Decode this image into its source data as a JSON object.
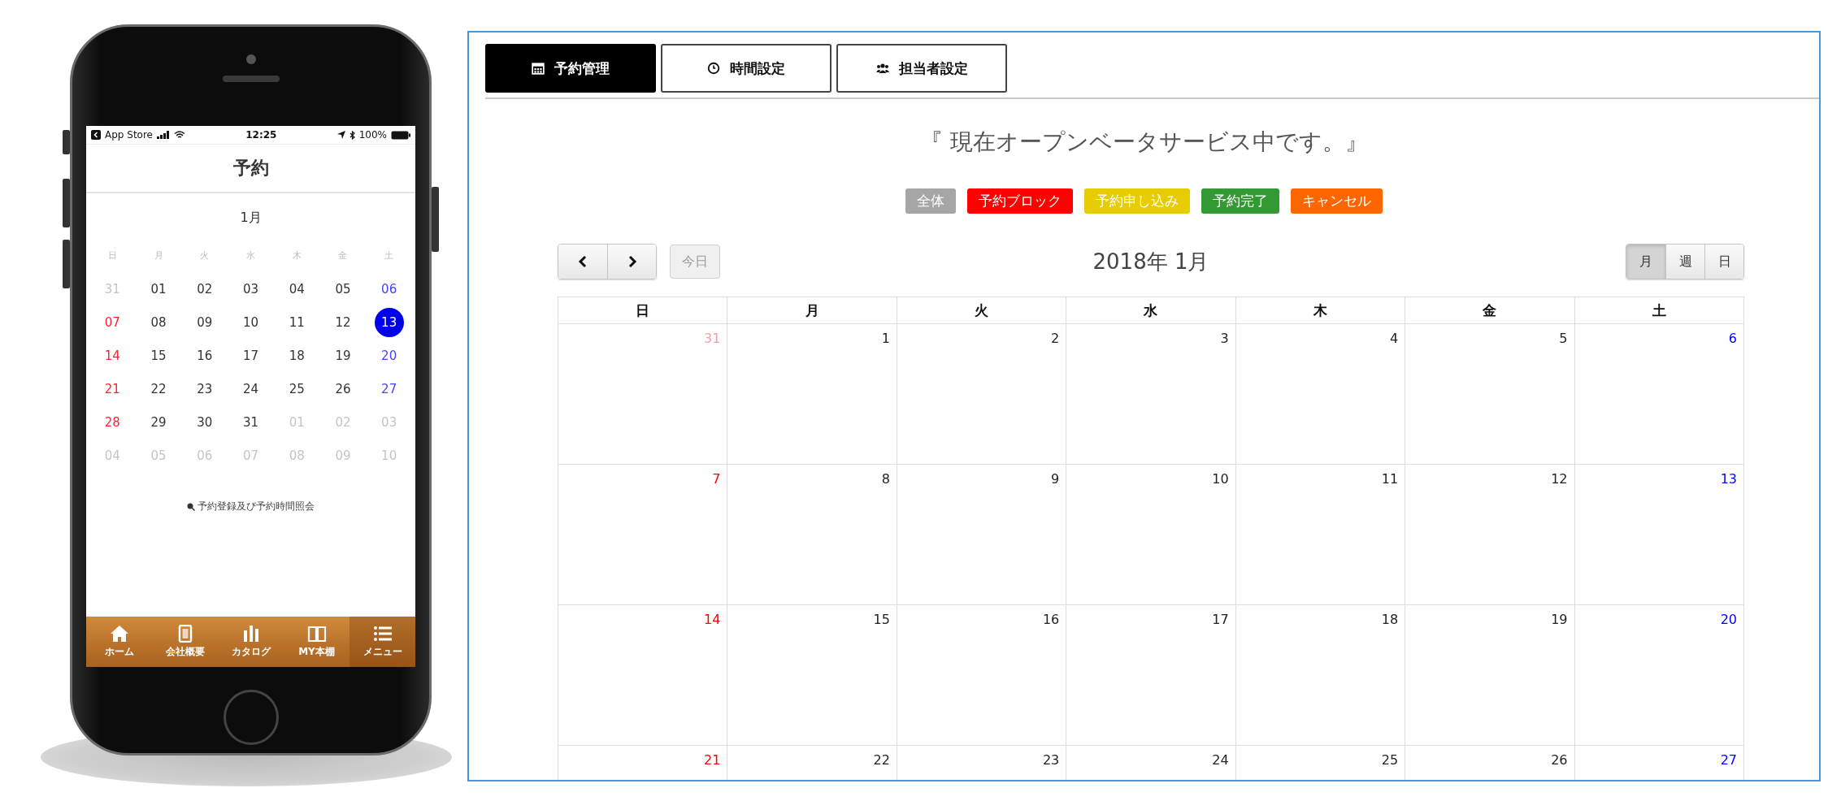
{
  "phone": {
    "status_bar": {
      "carrier": "App Store",
      "time": "12:25",
      "battery": "100%"
    },
    "title": "予約",
    "month": "1月",
    "weekdays": [
      "日",
      "月",
      "火",
      "水",
      "木",
      "金",
      "土"
    ],
    "weeks": [
      [
        {
          "label": "31",
          "kind": "outside",
          "selected": false
        },
        {
          "label": "01",
          "kind": "normal",
          "selected": false
        },
        {
          "label": "02",
          "kind": "normal",
          "selected": false
        },
        {
          "label": "03",
          "kind": "normal",
          "selected": false
        },
        {
          "label": "04",
          "kind": "normal",
          "selected": false
        },
        {
          "label": "05",
          "kind": "normal",
          "selected": false
        },
        {
          "label": "06",
          "kind": "saturday",
          "selected": false
        }
      ],
      [
        {
          "label": "07",
          "kind": "sunday",
          "selected": false
        },
        {
          "label": "08",
          "kind": "normal",
          "selected": false
        },
        {
          "label": "09",
          "kind": "normal",
          "selected": false
        },
        {
          "label": "10",
          "kind": "normal",
          "selected": false
        },
        {
          "label": "11",
          "kind": "normal",
          "selected": false
        },
        {
          "label": "12",
          "kind": "normal",
          "selected": false
        },
        {
          "label": "13",
          "kind": "saturday",
          "selected": true
        }
      ],
      [
        {
          "label": "14",
          "kind": "sunday",
          "selected": false
        },
        {
          "label": "15",
          "kind": "normal",
          "selected": false
        },
        {
          "label": "16",
          "kind": "normal",
          "selected": false
        },
        {
          "label": "17",
          "kind": "normal",
          "selected": false
        },
        {
          "label": "18",
          "kind": "normal",
          "selected": false
        },
        {
          "label": "19",
          "kind": "normal",
          "selected": false
        },
        {
          "label": "20",
          "kind": "saturday",
          "selected": false
        }
      ],
      [
        {
          "label": "21",
          "kind": "sunday",
          "selected": false
        },
        {
          "label": "22",
          "kind": "normal",
          "selected": false
        },
        {
          "label": "23",
          "kind": "normal",
          "selected": false
        },
        {
          "label": "24",
          "kind": "normal",
          "selected": false
        },
        {
          "label": "25",
          "kind": "normal",
          "selected": false
        },
        {
          "label": "26",
          "kind": "normal",
          "selected": false
        },
        {
          "label": "27",
          "kind": "saturday",
          "selected": false
        }
      ],
      [
        {
          "label": "28",
          "kind": "sunday",
          "selected": false
        },
        {
          "label": "29",
          "kind": "normal",
          "selected": false
        },
        {
          "label": "30",
          "kind": "normal",
          "selected": false
        },
        {
          "label": "31",
          "kind": "normal",
          "selected": false
        },
        {
          "label": "01",
          "kind": "outside",
          "selected": false
        },
        {
          "label": "02",
          "kind": "outside",
          "selected": false
        },
        {
          "label": "03",
          "kind": "outside",
          "selected": false
        }
      ],
      [
        {
          "label": "04",
          "kind": "outside",
          "selected": false
        },
        {
          "label": "05",
          "kind": "outside",
          "selected": false
        },
        {
          "label": "06",
          "kind": "outside",
          "selected": false
        },
        {
          "label": "07",
          "kind": "outside",
          "selected": false
        },
        {
          "label": "08",
          "kind": "outside",
          "selected": false
        },
        {
          "label": "09",
          "kind": "outside",
          "selected": false
        },
        {
          "label": "10",
          "kind": "outside",
          "selected": false
        }
      ]
    ],
    "link": "予約登録及び予約時間照会",
    "tab_bar": [
      {
        "label": "ホーム",
        "kind": "home",
        "selected": false
      },
      {
        "label": "会社概要",
        "kind": "document",
        "selected": false
      },
      {
        "label": "カタログ",
        "kind": "bars",
        "selected": false
      },
      {
        "label": "MY本棚",
        "kind": "book",
        "selected": false
      },
      {
        "label": "メニュー",
        "kind": "list",
        "selected": true
      }
    ]
  },
  "admin": {
    "tabs": [
      {
        "label": "予約管理",
        "kind": "calendar",
        "selected": true
      },
      {
        "label": "時間設定",
        "kind": "clock",
        "selected": false
      },
      {
        "label": "担当者設定",
        "kind": "people",
        "selected": false
      }
    ],
    "notice": "『 現在オープンベータサービス中です。』",
    "legend": [
      {
        "label": "全体",
        "color": "#a6a6a6"
      },
      {
        "label": "予約ブロック",
        "color": "#ff0000"
      },
      {
        "label": "予約申し込み",
        "color": "#e6cc00"
      },
      {
        "label": "予約完了",
        "color": "#339933"
      },
      {
        "label": "キャンセル",
        "color": "#ff6600"
      }
    ],
    "today": {
      "label": "今日",
      "disabled": true
    },
    "title": "2018年 1月",
    "views": [
      {
        "label": "月",
        "selected": true
      },
      {
        "label": "週",
        "selected": false
      },
      {
        "label": "日",
        "selected": false
      }
    ],
    "weekdays": [
      "日",
      "月",
      "火",
      "水",
      "木",
      "金",
      "土"
    ],
    "weeks": [
      [
        {
          "label": "31",
          "kind": "outside"
        },
        {
          "label": "1",
          "kind": "normal"
        },
        {
          "label": "2",
          "kind": "normal"
        },
        {
          "label": "3",
          "kind": "normal"
        },
        {
          "label": "4",
          "kind": "normal"
        },
        {
          "label": "5",
          "kind": "normal"
        },
        {
          "label": "6",
          "kind": "saturday"
        }
      ],
      [
        {
          "label": "7",
          "kind": "sunday"
        },
        {
          "label": "8",
          "kind": "normal"
        },
        {
          "label": "9",
          "kind": "normal"
        },
        {
          "label": "10",
          "kind": "normal"
        },
        {
          "label": "11",
          "kind": "normal"
        },
        {
          "label": "12",
          "kind": "normal"
        },
        {
          "label": "13",
          "kind": "saturday"
        }
      ],
      [
        {
          "label": "14",
          "kind": "sunday"
        },
        {
          "label": "15",
          "kind": "normal"
        },
        {
          "label": "16",
          "kind": "normal"
        },
        {
          "label": "17",
          "kind": "normal"
        },
        {
          "label": "18",
          "kind": "normal"
        },
        {
          "label": "19",
          "kind": "normal"
        },
        {
          "label": "20",
          "kind": "saturday"
        }
      ],
      [
        {
          "label": "21",
          "kind": "sunday"
        },
        {
          "label": "22",
          "kind": "normal"
        },
        {
          "label": "23",
          "kind": "normal"
        },
        {
          "label": "24",
          "kind": "normal"
        },
        {
          "label": "25",
          "kind": "normal"
        },
        {
          "label": "26",
          "kind": "normal"
        },
        {
          "label": "27",
          "kind": "saturday"
        }
      ]
    ]
  }
}
